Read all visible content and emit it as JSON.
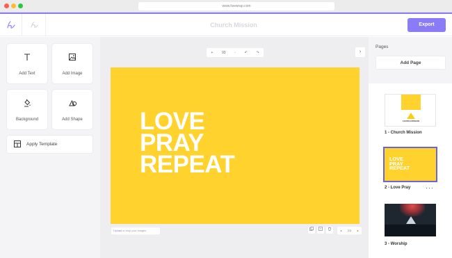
{
  "browser": {
    "url": "www.livewrap.com"
  },
  "header": {
    "title": "Church Mission",
    "export_label": "Export"
  },
  "tools": {
    "add_text": "Add Text",
    "add_image": "Add Image",
    "background": "Background",
    "add_shape": "Add Shape",
    "apply_template": "Apply Template"
  },
  "toolbar": {
    "zoom_out": "+",
    "zoom_level": "93",
    "zoom_in": "-",
    "undo": "↶",
    "redo": "↷",
    "next": "›"
  },
  "canvas": {
    "line1": "LOVE",
    "line2": "PRAY",
    "line3": "REPEAT",
    "background_color": "#ffd22e"
  },
  "footer": {
    "upload_link": "Upload",
    "upload_rest": " or drop your images",
    "page_indicator": "2/3",
    "prev": "◂",
    "next": "▸"
  },
  "pages": {
    "title": "Pages",
    "add_page_label": "Add Page",
    "items": [
      {
        "label": "1 - Church Mission",
        "mini_name": "CHURCH MISSION"
      },
      {
        "label": "2 - Love Pray",
        "mini_lines": [
          "LOVE",
          "PRAY",
          "REPEAT"
        ],
        "more": "···"
      },
      {
        "label": "3 - Worship"
      }
    ]
  },
  "colors": {
    "accent": "#8a7cf6",
    "canvas_yellow": "#ffd22e",
    "selected_outline": "#6b63d9"
  }
}
